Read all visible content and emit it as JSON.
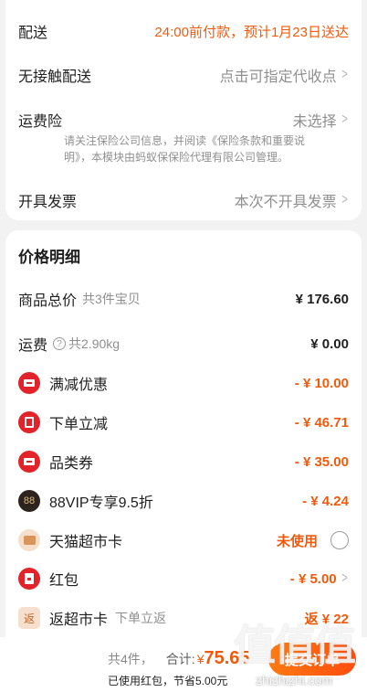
{
  "delivery": {
    "label": "配送",
    "value": "24:00前付款，预计1月23日送达"
  },
  "contactless": {
    "label": "无接触配送",
    "value": "点击可指定代收点"
  },
  "insurance": {
    "label": "运费险",
    "value": "未选择",
    "note": "请关注保险公司信息，并阅读《保险条款和重要说明》，本模块由蚂蚁保保险代理有限公司管理。"
  },
  "invoice": {
    "label": "开具发票",
    "value": "本次不开具发票"
  },
  "price_detail": {
    "title": "价格明细",
    "goods_total": {
      "label": "商品总价",
      "sub": "共3件宝贝",
      "value": "¥ 176.60"
    },
    "shipping": {
      "label": "运费",
      "sub": "共2.90kg",
      "value": "¥ 0.00",
      "help_icon": "question-circle-icon"
    },
    "items": [
      {
        "label": "满减优惠",
        "value": "- ¥ 10.00",
        "icon": "coupon-icon"
      },
      {
        "label": "下单立减",
        "value": "- ¥ 46.71",
        "icon": "bill-icon"
      },
      {
        "label": "品类券",
        "value": "- ¥ 35.00",
        "icon": "coupon-icon"
      },
      {
        "label": "88VIP专享9.5折",
        "value": "- ¥ 4.24",
        "icon": "vip-88-icon",
        "icon_text": "88"
      },
      {
        "label": "天猫超市卡",
        "value": "未使用",
        "icon": "card-icon"
      },
      {
        "label": "红包",
        "value": "- ¥ 5.00",
        "icon": "red-packet-icon"
      },
      {
        "label": "返超市卡",
        "sub": "下单立返",
        "value": "返 ¥ 22",
        "icon": "return-icon",
        "icon_text": "返"
      }
    ]
  },
  "footer": {
    "count": "共4件，",
    "total_label": "合计:",
    "currency": "¥",
    "total": "75.65",
    "saved": "已使用红包，节省5.00元",
    "submit": "提交订单"
  },
  "watermark": {
    "big": "值值值",
    "small": "zhizhizhi.com"
  },
  "colors": {
    "accent": "#f05a0d",
    "icon_red": "#e2232a",
    "vip_dark": "#2d231e"
  }
}
